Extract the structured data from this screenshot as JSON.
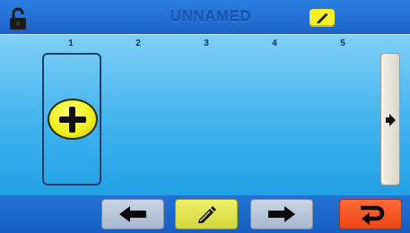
{
  "header": {
    "title": "UNNAMED",
    "lock_icon": "lock-open-icon",
    "edit_icon": "pencil-icon"
  },
  "columns": [
    "1",
    "2",
    "3",
    "4",
    "5"
  ],
  "slot": {
    "add_icon": "plus-icon"
  },
  "scroll": {
    "icon": "arrow-right-icon"
  },
  "footer": {
    "buttons": [
      {
        "icon": "arrow-left-icon",
        "color": "#b4c2d8"
      },
      {
        "icon": "pencil-icon",
        "color": "#e2e34a"
      },
      {
        "icon": "arrow-right-icon",
        "color": "#b4c2d8"
      },
      {
        "icon": "return-icon",
        "color": "#f5541e"
      }
    ]
  },
  "colors": {
    "header_bg": "#2277d8",
    "panel_bg": "#40b3ee",
    "accent_yellow": "#f4ef2c",
    "accent_red": "#f5541e"
  }
}
